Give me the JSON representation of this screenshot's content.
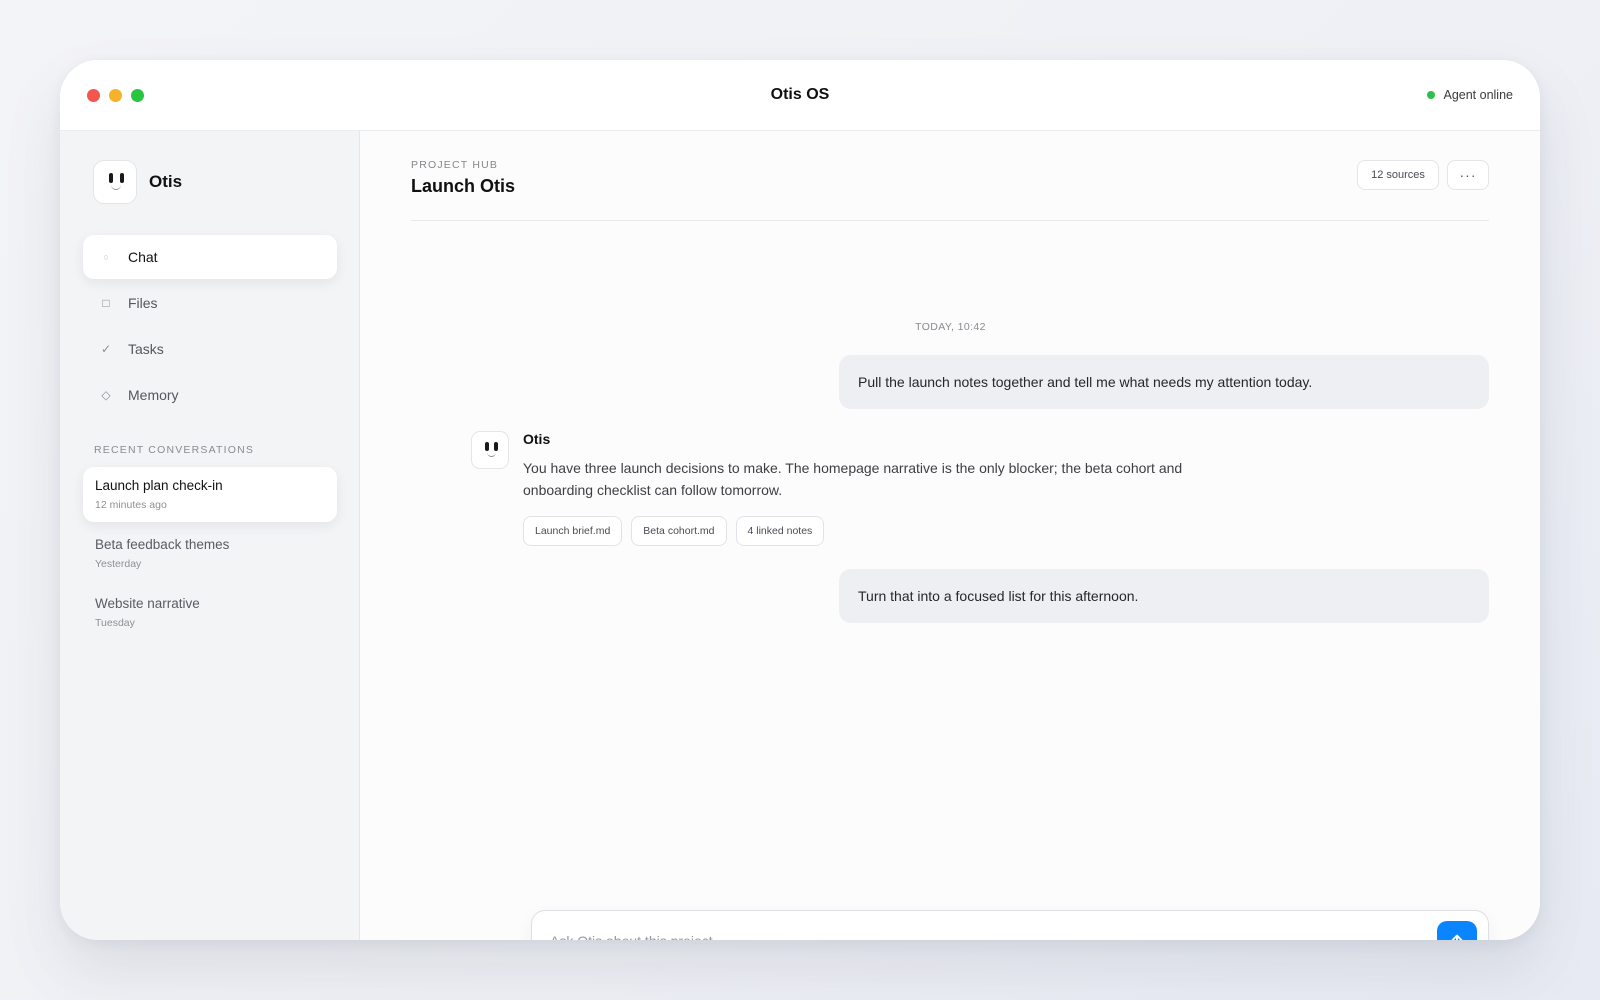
{
  "window": {
    "title": "Otis OS",
    "status": "Agent online"
  },
  "sidebar": {
    "brand": "Otis",
    "nav": [
      {
        "label": "Chat",
        "icon": "circle-icon",
        "active": true
      },
      {
        "label": "Files",
        "icon": "square-icon",
        "active": false
      },
      {
        "label": "Tasks",
        "icon": "check-icon",
        "active": false
      },
      {
        "label": "Memory",
        "icon": "diamond-icon",
        "active": false
      }
    ],
    "recent_label": "RECENT CONVERSATIONS",
    "recent": [
      {
        "title": "Launch plan check-in",
        "time": "12 minutes ago",
        "active": true
      },
      {
        "title": "Beta feedback themes",
        "time": "Yesterday",
        "active": false
      },
      {
        "title": "Website narrative",
        "time": "Tuesday",
        "active": false
      }
    ]
  },
  "main": {
    "eyebrow": "PROJECT HUB",
    "title": "Launch Otis",
    "sources_label": "12 sources",
    "more_label": "···",
    "timestamp": "TODAY, 10:42",
    "messages": {
      "user_1": "Pull the launch notes together and tell me what needs my attention today.",
      "agent_name": "Otis",
      "agent_text": "You have three launch decisions to make. The homepage narrative is the only blocker; the beta cohort and onboarding checklist can follow tomorrow.",
      "attachments": [
        "Launch brief.md",
        "Beta cohort.md",
        "4 linked notes"
      ],
      "user_2": "Turn that into a focused list for this afternoon."
    },
    "composer": {
      "placeholder": "Ask Otis about this project..."
    }
  },
  "colors": {
    "accent": "#0a84ff",
    "online": "#2fbf4f",
    "close": "#f2574f",
    "minimize": "#f6b22e",
    "maximize": "#29c440"
  }
}
